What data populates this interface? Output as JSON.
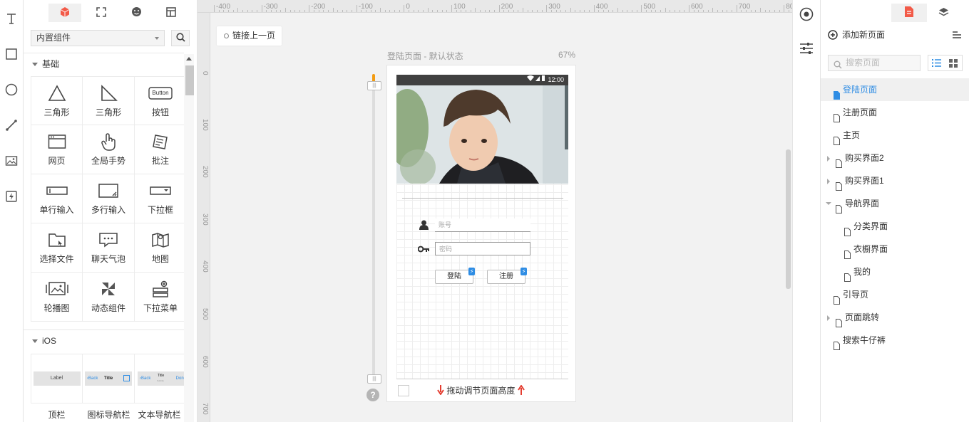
{
  "library": {
    "dropdown_value": "内置组件",
    "sections": {
      "basic": "基础",
      "ios": "iOS"
    },
    "widgets": [
      {
        "label": "三角形",
        "icon": "triangle-icon"
      },
      {
        "label": "三角形",
        "icon": "right-triangle-icon"
      },
      {
        "label": "按钮",
        "icon": "button-icon",
        "icon_text": "Button"
      },
      {
        "label": "网页",
        "icon": "webpage-icon"
      },
      {
        "label": "全局手势",
        "icon": "hand-gesture-icon"
      },
      {
        "label": "批注",
        "icon": "annotation-icon"
      },
      {
        "label": "单行输入",
        "icon": "single-line-input-icon"
      },
      {
        "label": "多行输入",
        "icon": "multi-line-input-icon"
      },
      {
        "label": "下拉框",
        "icon": "dropdown-box-icon"
      },
      {
        "label": "选择文件",
        "icon": "folder-icon"
      },
      {
        "label": "聊天气泡",
        "icon": "chat-bubble-icon"
      },
      {
        "label": "地图",
        "icon": "map-icon"
      },
      {
        "label": "轮播图",
        "icon": "carousel-icon"
      },
      {
        "label": "动态组件",
        "icon": "pinwheel-icon"
      },
      {
        "label": "下拉菜单",
        "icon": "dropdown-menu-icon"
      }
    ],
    "ios_widgets": [
      {
        "label": "顶栏",
        "preview": "Label"
      },
      {
        "label": "图标导航栏",
        "preview_back": "Back",
        "preview_title": "Title"
      },
      {
        "label": "文本导航栏",
        "preview_back": "Back",
        "preview_title": "Title",
        "preview_sub": "Subtitle",
        "preview_done": "Done"
      }
    ]
  },
  "canvas": {
    "h_ruler": [
      "-400",
      "-300",
      "-200",
      "-100",
      "0",
      "100",
      "200",
      "300",
      "400",
      "500",
      "600",
      "700",
      "800"
    ],
    "v_ruler": [
      "0",
      "100",
      "200",
      "300",
      "400",
      "500",
      "600",
      "700"
    ],
    "link_prev": "链接上一页",
    "page_heading": "登陆页面 - 默认状态",
    "zoom": "67%",
    "phone": {
      "status_time": "12:00",
      "account_placeholder": "账号",
      "password_placeholder": "密码",
      "login_button": "登陆",
      "register_button": "注册"
    },
    "drag_hint": "拖动调节页面高度",
    "help": "?",
    "handle_grip": "|||"
  },
  "pages": {
    "add_page": "添加新页面",
    "search_placeholder": "搜索页面",
    "items": [
      {
        "name": "登陆页面",
        "indent": 0,
        "arrow": "",
        "selected": true
      },
      {
        "name": "注册页面",
        "indent": 0,
        "arrow": ""
      },
      {
        "name": "主页",
        "indent": 0,
        "arrow": ""
      },
      {
        "name": "购买界面2",
        "indent": 0,
        "arrow": "right"
      },
      {
        "name": "购买界面1",
        "indent": 0,
        "arrow": "right"
      },
      {
        "name": "导航界面",
        "indent": 0,
        "arrow": "down"
      },
      {
        "name": "分类界面",
        "indent": 1,
        "arrow": ""
      },
      {
        "name": "衣橱界面",
        "indent": 1,
        "arrow": ""
      },
      {
        "name": "我的",
        "indent": 1,
        "arrow": ""
      },
      {
        "name": "引导页",
        "indent": 0,
        "arrow": ""
      },
      {
        "name": "页面跳转",
        "indent": 0,
        "arrow": "right"
      },
      {
        "name": "搜索牛仔裤",
        "indent": 0,
        "arrow": ""
      }
    ]
  },
  "colors": {
    "accent": "#2f8de4",
    "brand_red": "#f25a48",
    "arrow_red": "#e43d30"
  }
}
